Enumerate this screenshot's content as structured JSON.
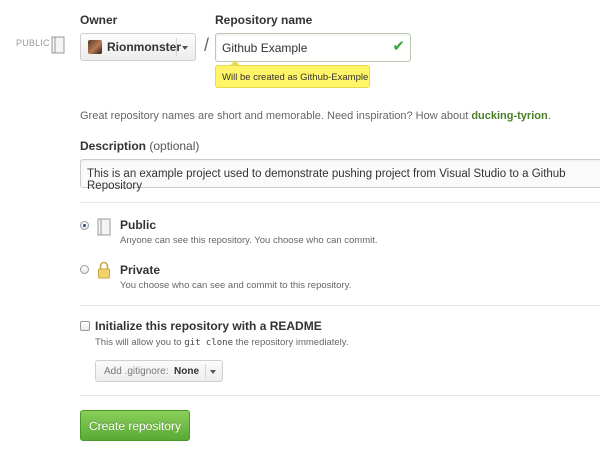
{
  "form": {
    "owner_label": "Owner",
    "repo_name_label": "Repository name",
    "visibility_side_label": "PUBLIC",
    "owner_value": "Rionmonster",
    "slash": "/",
    "repo_name_value": "Github Example",
    "check_icon": "✔",
    "tooltip": "Will be created as Github-Example",
    "hint_prefix": "Great repository names are short and memorable. Need inspiration? How about ",
    "hint_suggestion": "ducking-tyrion",
    "hint_suffix": ".",
    "description_label": "Description",
    "description_optional": " (optional)",
    "description_value": "This is an example project used to demonstrate pushing project from Visual Studio to a Github Repository"
  },
  "visibility": {
    "selected": "public",
    "public": {
      "title": "Public",
      "subtitle": "Anyone can see this repository. You choose who can commit."
    },
    "private": {
      "title": "Private",
      "subtitle": "You choose who can see and commit to this repository."
    }
  },
  "readme": {
    "checked": false,
    "title": "Initialize this repository with a README",
    "subtitle_prefix": "This will allow you to ",
    "subtitle_code": "git clone",
    "subtitle_suffix": " the repository immediately."
  },
  "gitignore": {
    "add_label": "Add .gitignore:",
    "value": "None"
  },
  "actions": {
    "create_label": "Create repository"
  },
  "colors": {
    "create_button": "#5aa835",
    "tooltip_bg": "#fff566",
    "suggestion_text": "#4a7f2a",
    "check": "#3aa33a"
  }
}
